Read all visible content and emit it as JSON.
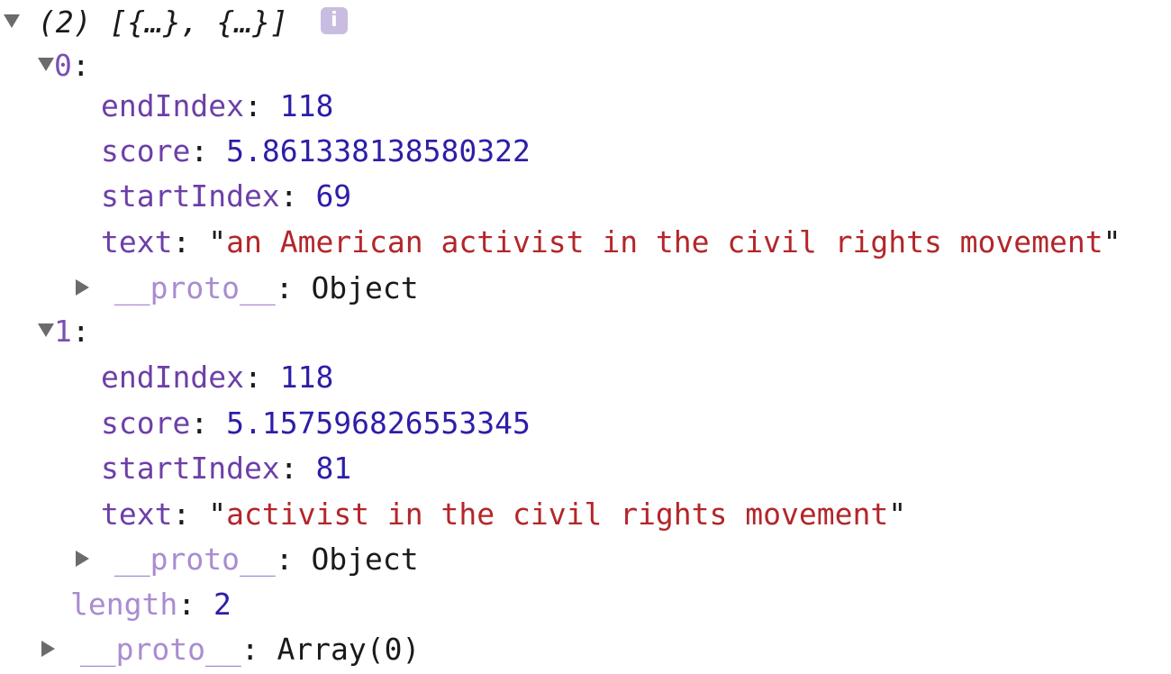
{
  "console": {
    "summary": "(2) [{…}, {…}]",
    "info_icon": "info-icon",
    "items": [
      {
        "index": "0",
        "fields": [
          {
            "key": "endIndex",
            "value": "118",
            "type": "number"
          },
          {
            "key": "score",
            "value": "5.861338138580322",
            "type": "number"
          },
          {
            "key": "startIndex",
            "value": "69",
            "type": "number"
          },
          {
            "key": "text",
            "value": "an American activist in the civil rights movement",
            "type": "string"
          }
        ],
        "proto_key": "__proto__",
        "proto_value": "Object"
      },
      {
        "index": "1",
        "fields": [
          {
            "key": "endIndex",
            "value": "118",
            "type": "number"
          },
          {
            "key": "score",
            "value": "5.157596826553345",
            "type": "number"
          },
          {
            "key": "startIndex",
            "value": "81",
            "type": "number"
          },
          {
            "key": "text",
            "value": "activist in the civil rights movement",
            "type": "string"
          }
        ],
        "proto_key": "__proto__",
        "proto_value": "Object"
      }
    ],
    "length_key": "length",
    "length_value": "2",
    "array_proto_key": "__proto__",
    "array_proto_value": "Array(0)"
  },
  "colors": {
    "key": "#6d3fa8",
    "number": "#2c1ea8",
    "string": "#b3262a",
    "dim_key": "#a98cd0"
  }
}
